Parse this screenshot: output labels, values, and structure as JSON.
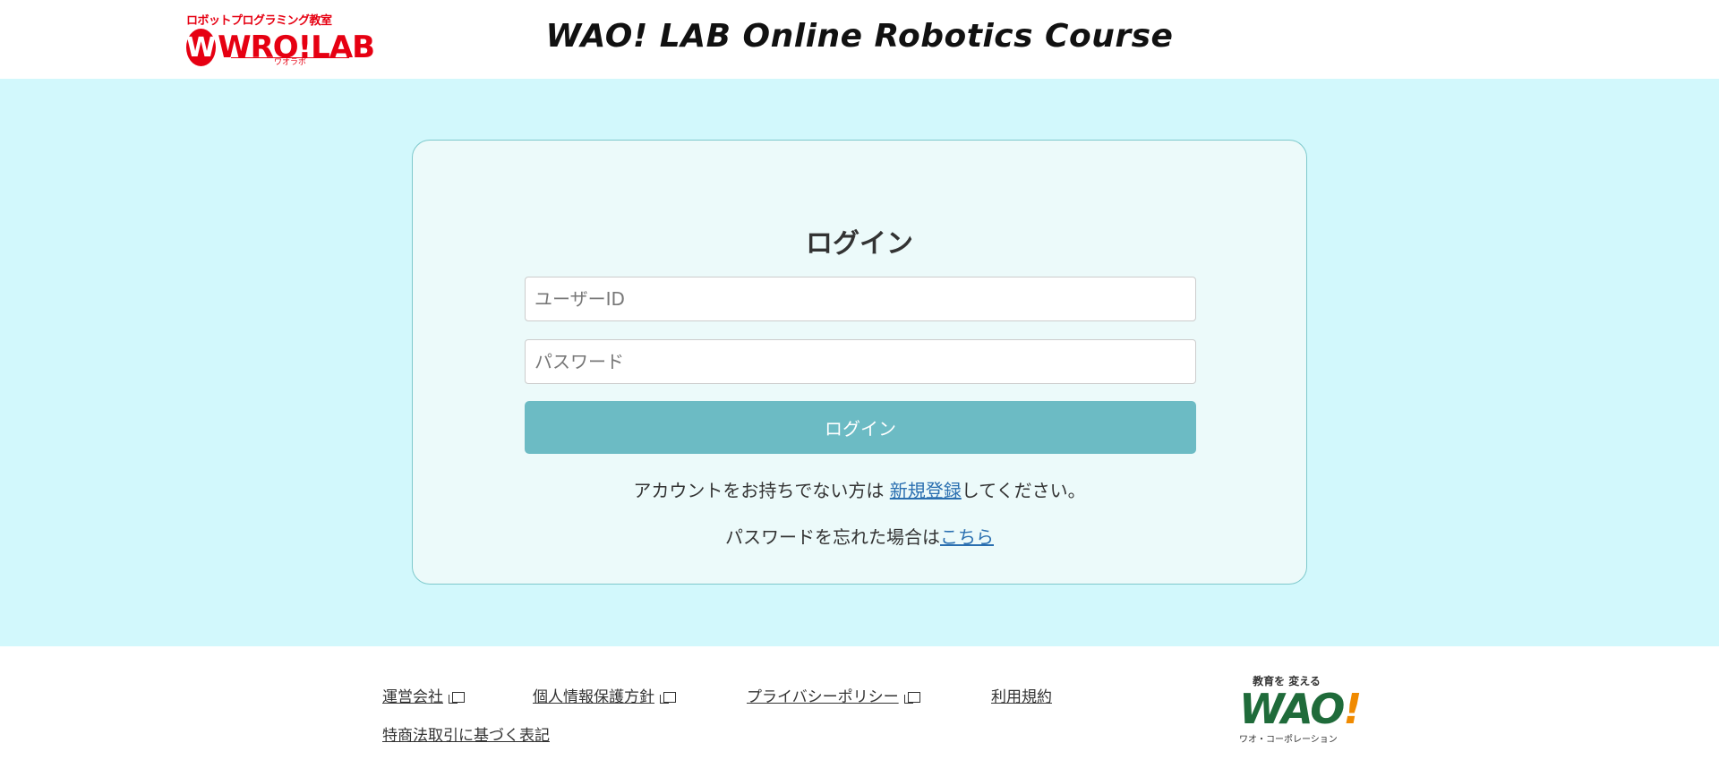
{
  "header": {
    "logo": {
      "top_text": "ロボットプログラミング教室",
      "wordmark": "WRO!LAB",
      "sub_text": "ワオラボ",
      "brand_color": "#e60012"
    },
    "title": "WAO! LAB Online Robotics Course"
  },
  "login": {
    "heading": "ログイン",
    "user_placeholder": "ユーザーID",
    "password_placeholder": "パスワード",
    "button_label": "ログイン",
    "button_color": "#6cbbc4",
    "register_prefix": "アカウントをお持ちでない方は",
    "register_link": "新規登録",
    "register_suffix": "してください。",
    "forgot_prefix": "パスワードを忘れた場合は",
    "forgot_link": "こちら"
  },
  "footer": {
    "links": [
      {
        "label": "運営会社",
        "external": true
      },
      {
        "label": "個人情報保護方針",
        "external": true
      },
      {
        "label": "プライバシーポリシー",
        "external": true
      },
      {
        "label": "利用規約",
        "external": false
      },
      {
        "label": "特商法取引に基づく表記",
        "external": false
      }
    ],
    "logo": {
      "top_text": "教育を 変える",
      "wordmark": "WAO",
      "exclamation": "!",
      "sub_text": "ワオ・コーポレーション"
    }
  },
  "colors": {
    "main_bg": "#d2f8fc",
    "card_bg": "#ecfafa",
    "link": "#2a6fb0"
  }
}
